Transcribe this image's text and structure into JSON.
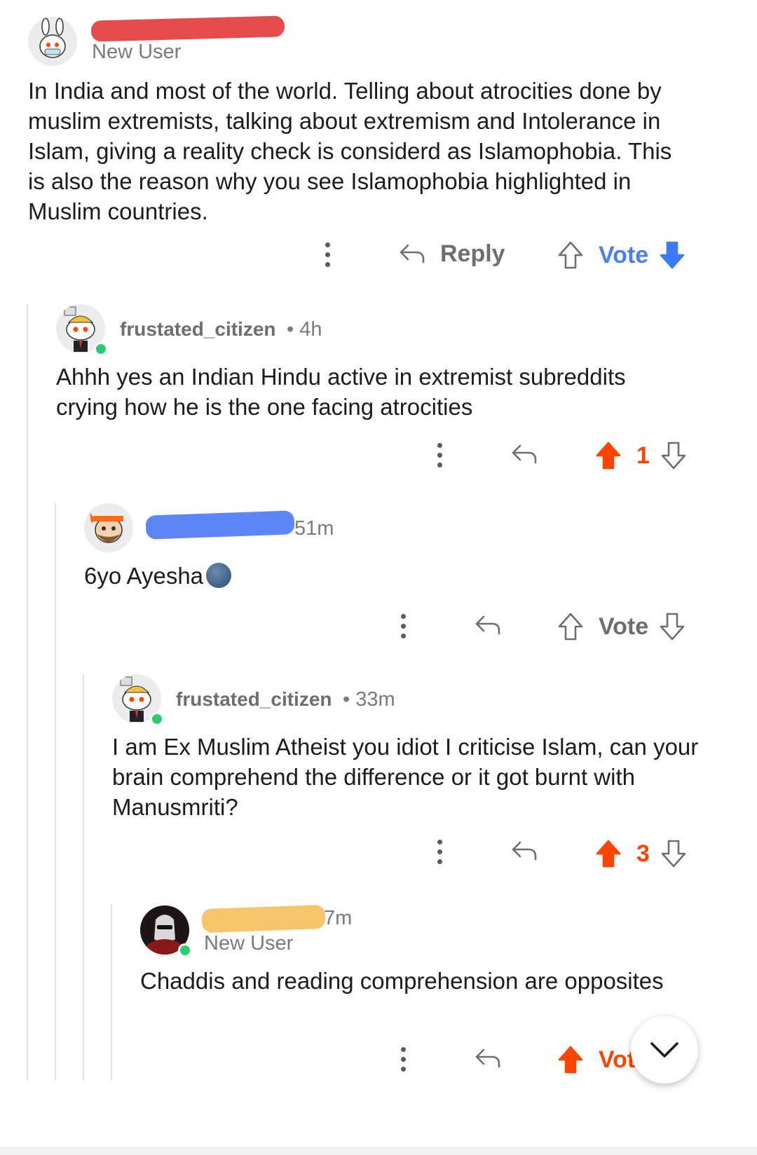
{
  "colors": {
    "upvote_active": "#ff4500",
    "downvote_active": "#3b7bf6",
    "vote_blue": "#4a7ff0",
    "muted": "#6e6e6e",
    "redact_red": "#e74c4c",
    "redact_blue": "#5e85f5",
    "redact_yellow": "#f6c56a"
  },
  "comments": [
    {
      "id": "c1",
      "username": "",
      "flair": "New User",
      "time": "",
      "body": "In India and most of the world. Telling about atrocities done by muslim extremists,  talking about extremism and Intolerance in Islam, giving a reality check is considerd as Islamophobia. This is also the reason why you see Islamophobia highlighted in Muslim countries.",
      "reply_label": "Reply",
      "vote_label": "Vote",
      "vote_state": "downvoted"
    },
    {
      "id": "c2",
      "username": "frustated_citizen",
      "time": "• 4h",
      "body": "Ahhh yes an Indian Hindu active in extremist subreddits crying how he is the one facing atrocities",
      "score": "1",
      "vote_state": "upvoted"
    },
    {
      "id": "c3",
      "username": "",
      "time": "51m",
      "body": "6yo Ayesha",
      "emoji": "new-moon-face",
      "vote_label": "Vote",
      "vote_state": "none"
    },
    {
      "id": "c4",
      "username": "frustated_citizen",
      "time": "• 33m",
      "body": "I am Ex Muslim Atheist you idiot I criticise Islam, can your brain comprehend the difference or it got burnt with Manusmriti?",
      "score": "3",
      "vote_state": "upvoted"
    },
    {
      "id": "c5",
      "username": "",
      "flair": "New User",
      "time": "7m",
      "body": "Chaddis and reading comprehension are opposites",
      "vote_label": "Vot",
      "vote_state": "upvoted"
    }
  ],
  "icons": {
    "more": "more-vertical-icon",
    "reply": "reply-arrow-icon",
    "upvote": "upvote-arrow-icon",
    "downvote": "downvote-arrow-icon",
    "scroll": "chevron-down-icon"
  }
}
